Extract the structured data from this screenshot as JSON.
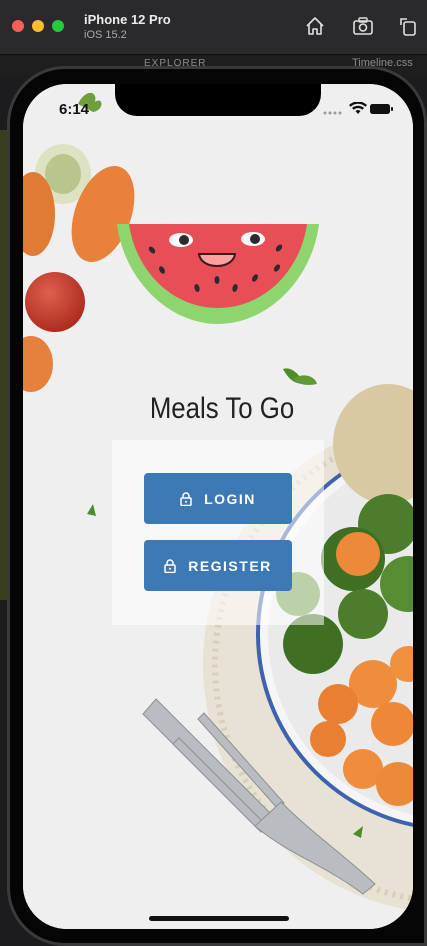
{
  "simulator": {
    "device_name": "iPhone 12 Pro",
    "os_version": "iOS 15.2",
    "toolbar_icons": [
      "home-icon",
      "screenshot-icon",
      "rotate-icon"
    ]
  },
  "background_editor": {
    "explorer_label": "EXPLORER",
    "open_file": "Timeline.css"
  },
  "status_bar": {
    "time": "6:14"
  },
  "app": {
    "title": "Meals To Go",
    "login_label": "LOGIN",
    "register_label": "REGISTER",
    "button_color": "#3d7ab5",
    "logo": "watermelon-logo"
  }
}
